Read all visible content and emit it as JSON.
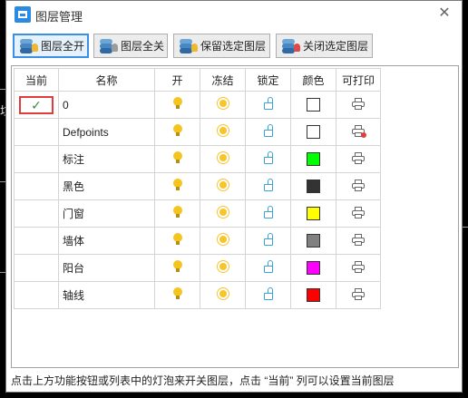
{
  "window": {
    "title": "图层管理",
    "close_label": "✕"
  },
  "side_text": "垃",
  "toolbar": [
    {
      "label": "图层全开",
      "icon": "layers-on-icon"
    },
    {
      "label": "图层全关",
      "icon": "layers-off-icon"
    },
    {
      "label": "保留选定图层",
      "icon": "layers-keep-icon"
    },
    {
      "label": "关闭选定图层",
      "icon": "layers-close-icon"
    }
  ],
  "columns": [
    "当前",
    "名称",
    "开",
    "冻结",
    "锁定",
    "颜色",
    "可打印"
  ],
  "current_mark": "✓",
  "layers": [
    {
      "name": "0",
      "current": true,
      "color": "#ffffff",
      "printable": true
    },
    {
      "name": "Defpoints",
      "current": false,
      "color": "#ffffff",
      "printable": false
    },
    {
      "name": "标注",
      "current": false,
      "color": "#00ff00",
      "printable": true
    },
    {
      "name": "黑色",
      "current": false,
      "color": "#333333",
      "printable": true
    },
    {
      "name": "门窗",
      "current": false,
      "color": "#ffff00",
      "printable": true
    },
    {
      "name": "墙体",
      "current": false,
      "color": "#808080",
      "printable": true
    },
    {
      "name": "阳台",
      "current": false,
      "color": "#ff00ff",
      "printable": true
    },
    {
      "name": "轴线",
      "current": false,
      "color": "#ff0000",
      "printable": true
    }
  ],
  "status_text": "点击上方功能按钮或列表中的灯泡来开关图层，点击 “当前” 列可以设置当前图层"
}
